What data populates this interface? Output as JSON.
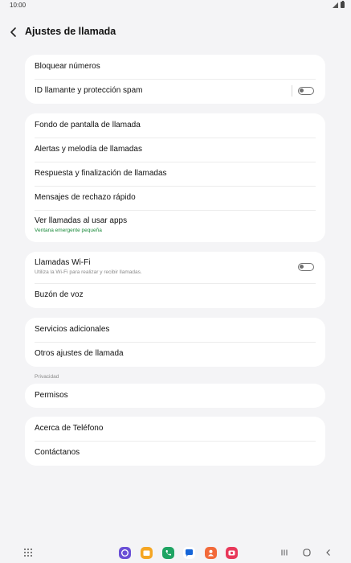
{
  "status_bar": {
    "time": "10:00",
    "icons": [
      "signal-icon",
      "battery-icon"
    ]
  },
  "header": {
    "back_icon": "chevron-left-icon",
    "title": "Ajustes de llamada"
  },
  "cards": [
    {
      "items": [
        {
          "label": "Bloquear números"
        },
        {
          "label": "ID llamante y protección spam",
          "toggle": false
        }
      ]
    },
    {
      "items": [
        {
          "label": "Fondo de pantalla de llamada"
        },
        {
          "label": "Alertas y melodía de llamadas"
        },
        {
          "label": "Respuesta y finalización de llamadas"
        },
        {
          "label": "Mensajes de rechazo rápido"
        },
        {
          "label": "Ver llamadas al usar apps",
          "sublabel": "Ventana emergente pequeña"
        }
      ]
    },
    {
      "items": [
        {
          "label": "Llamadas Wi-Fi",
          "sublabel": "Utiliza la Wi-Fi para realizar y recibir llamadas.",
          "toggle": false
        },
        {
          "label": "Buzón de voz"
        }
      ]
    },
    {
      "items": [
        {
          "label": "Servicios adicionales"
        },
        {
          "label": "Otros ajustes de llamada"
        }
      ]
    },
    {
      "section_label": "Privacidad",
      "items": [
        {
          "label": "Permisos"
        }
      ]
    },
    {
      "items": [
        {
          "label": "Acerca de Teléfono"
        },
        {
          "label": "Contáctanos"
        }
      ]
    }
  ],
  "colors": {
    "background": "#f4f4f6",
    "card": "#ffffff",
    "accent_green": "#1a8a3a",
    "toggle_off": "#6f6f6f"
  },
  "navbar": {
    "apps_icon": "apps-grid-icon",
    "dock_apps": [
      "internet-app-icon",
      "files-app-icon",
      "phone-app-icon",
      "messages-app-icon",
      "contacts-app-icon",
      "camera-app-icon"
    ],
    "buttons": [
      "recents-icon",
      "home-icon",
      "back-icon"
    ]
  }
}
